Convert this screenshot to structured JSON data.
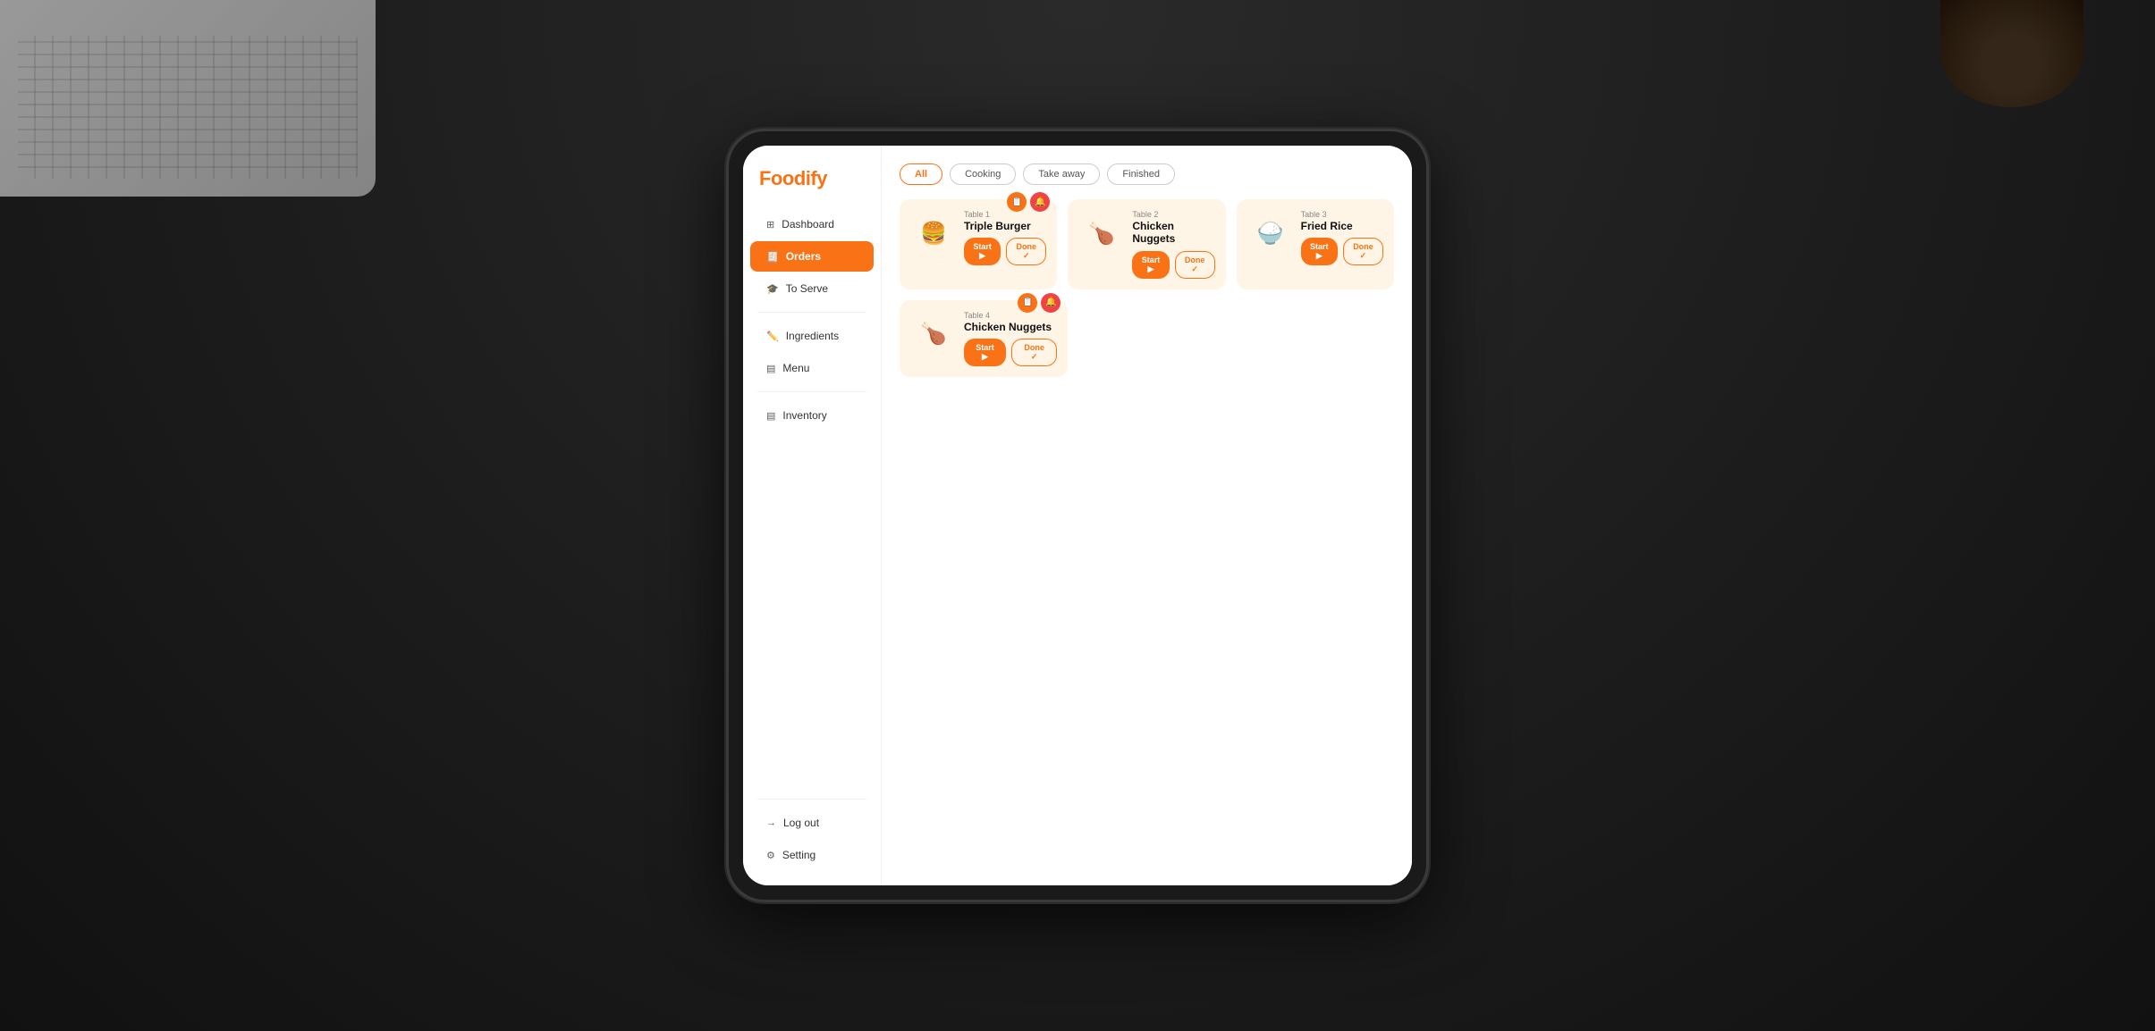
{
  "background": {
    "color": "#1a1a1a"
  },
  "app": {
    "logo": "Foodify"
  },
  "sidebar": {
    "items": [
      {
        "id": "dashboard",
        "label": "Dashboard",
        "icon": "⊞",
        "active": false
      },
      {
        "id": "orders",
        "label": "Orders",
        "icon": "🧾",
        "active": true
      },
      {
        "id": "to-serve",
        "label": "To Serve",
        "icon": "🎓",
        "active": false
      },
      {
        "id": "ingredients",
        "label": "Ingredients",
        "icon": "✏️",
        "active": false
      },
      {
        "id": "menu",
        "label": "Menu",
        "icon": "▤",
        "active": false
      },
      {
        "id": "inventory",
        "label": "Inventory",
        "icon": "▤",
        "active": false
      }
    ],
    "bottom": [
      {
        "id": "logout",
        "label": "Log out",
        "icon": "→"
      },
      {
        "id": "setting",
        "label": "Setting",
        "icon": "⚙"
      }
    ]
  },
  "filters": [
    {
      "id": "all",
      "label": "All",
      "active": true
    },
    {
      "id": "cooking",
      "label": "Cooking",
      "active": false
    },
    {
      "id": "takeaway",
      "label": "Take away",
      "active": false
    },
    {
      "id": "finished",
      "label": "Finished",
      "active": false
    }
  ],
  "orders": [
    {
      "id": "order1",
      "table": "Table 1",
      "name": "Triple Burger",
      "emoji": "🍔",
      "badges": [
        "📋",
        "🔔"
      ],
      "badge_colors": [
        "orange",
        "red"
      ]
    },
    {
      "id": "order2",
      "table": "Table 2",
      "name": "Chicken Nuggets",
      "emoji": "🍗",
      "badges": [],
      "badge_colors": []
    },
    {
      "id": "order3",
      "table": "Table 3",
      "name": "Fried Rice",
      "emoji": "🍚",
      "badges": [],
      "badge_colors": []
    },
    {
      "id": "order4",
      "table": "Table 4",
      "name": "Chicken Nuggets",
      "emoji": "🍗",
      "badges": [
        "📋",
        "🔔"
      ],
      "badge_colors": [
        "orange",
        "red"
      ]
    }
  ],
  "buttons": {
    "start": "Start ▶",
    "done": "Done ✓"
  }
}
